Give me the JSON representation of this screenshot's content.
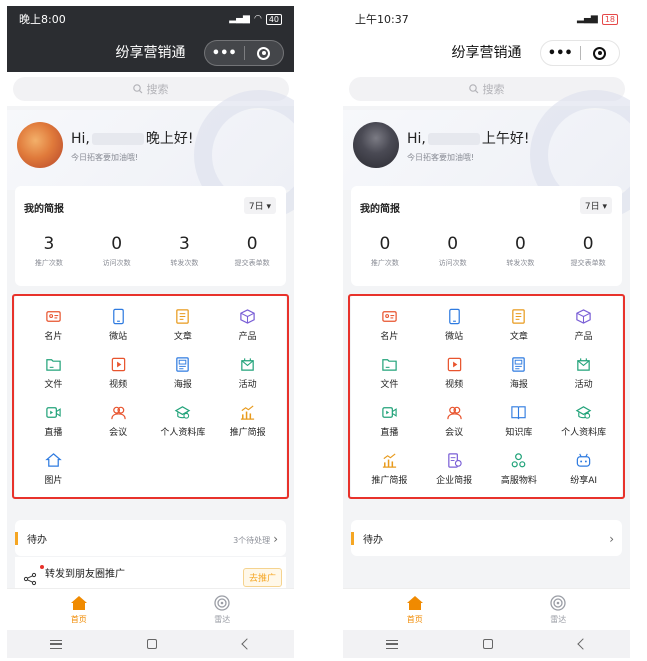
{
  "phones": [
    {
      "theme": "dark",
      "status": {
        "time": "晚上8:00",
        "battery": "40"
      },
      "title": "纷享营销通",
      "search_placeholder": "搜索",
      "greeting": {
        "prefix": "Hi,",
        "suffix": "晚上好!",
        "subtitle": "今日拓客要加油哦!"
      },
      "report": {
        "title": "我的简报",
        "period": "7日",
        "stats": [
          {
            "value": "3",
            "label": "推广次数"
          },
          {
            "value": "0",
            "label": "访问次数"
          },
          {
            "value": "3",
            "label": "转发次数"
          },
          {
            "value": "0",
            "label": "提交表单数"
          }
        ]
      },
      "grid": [
        {
          "label": "名片",
          "icon": "card-icon",
          "color": "#e8542e"
        },
        {
          "label": "微站",
          "icon": "tablet-icon",
          "color": "#2f7be0"
        },
        {
          "label": "文章",
          "icon": "article-icon",
          "color": "#e89a1c"
        },
        {
          "label": "产品",
          "icon": "cube-icon",
          "color": "#7a5fd6"
        },
        {
          "label": "文件",
          "icon": "folder-icon",
          "color": "#22a37a"
        },
        {
          "label": "视频",
          "icon": "video-icon",
          "color": "#e8542e"
        },
        {
          "label": "海报",
          "icon": "poster-icon",
          "color": "#2f7be0"
        },
        {
          "label": "活动",
          "icon": "event-icon",
          "color": "#22a37a"
        },
        {
          "label": "直播",
          "icon": "live-icon",
          "color": "#22a37a"
        },
        {
          "label": "会议",
          "icon": "meeting-icon",
          "color": "#e8542e"
        },
        {
          "label": "个人资料库",
          "icon": "library-icon",
          "color": "#22a37a"
        },
        {
          "label": "推广简报",
          "icon": "chart-icon",
          "color": "#e89a1c"
        },
        {
          "label": "图片",
          "icon": "home-icon",
          "color": "#2f7be0"
        }
      ],
      "todo": {
        "title": "待办",
        "right": "3个待处理",
        "arrow": "›"
      },
      "promo": {
        "text": "转发到朋友圈推广",
        "button": "去推广"
      },
      "tabs": [
        {
          "label": "首页",
          "active": true
        },
        {
          "label": "雷达",
          "active": false
        }
      ]
    },
    {
      "theme": "light",
      "status": {
        "time": "上午10:37",
        "battery": "18"
      },
      "title": "纷享营销通",
      "search_placeholder": "搜索",
      "greeting": {
        "prefix": "Hi,",
        "suffix": "上午好!",
        "subtitle": "今日拓客要加油哦!"
      },
      "report": {
        "title": "我的简报",
        "period": "7日",
        "stats": [
          {
            "value": "0",
            "label": "推广次数"
          },
          {
            "value": "0",
            "label": "访问次数"
          },
          {
            "value": "0",
            "label": "转发次数"
          },
          {
            "value": "0",
            "label": "提交表单数"
          }
        ]
      },
      "grid": [
        {
          "label": "名片",
          "icon": "card-icon",
          "color": "#e8542e"
        },
        {
          "label": "微站",
          "icon": "tablet-icon",
          "color": "#2f7be0"
        },
        {
          "label": "文章",
          "icon": "article-icon",
          "color": "#e89a1c"
        },
        {
          "label": "产品",
          "icon": "cube-icon",
          "color": "#7a5fd6"
        },
        {
          "label": "文件",
          "icon": "folder-icon",
          "color": "#22a37a"
        },
        {
          "label": "视频",
          "icon": "video-icon",
          "color": "#e8542e"
        },
        {
          "label": "海报",
          "icon": "poster-icon",
          "color": "#2f7be0"
        },
        {
          "label": "活动",
          "icon": "event-icon",
          "color": "#22a37a"
        },
        {
          "label": "直播",
          "icon": "live-icon",
          "color": "#22a37a"
        },
        {
          "label": "会议",
          "icon": "meeting-icon",
          "color": "#e8542e"
        },
        {
          "label": "知识库",
          "icon": "book-icon",
          "color": "#2f7be0"
        },
        {
          "label": "个人资料库",
          "icon": "library-icon",
          "color": "#22a37a"
        },
        {
          "label": "推广简报",
          "icon": "chart-icon",
          "color": "#e89a1c"
        },
        {
          "label": "企业简报",
          "icon": "report-icon",
          "color": "#7a5fd6"
        },
        {
          "label": "高服物料",
          "icon": "nodes-icon",
          "color": "#22a37a"
        },
        {
          "label": "纷享AI",
          "icon": "robot-icon",
          "color": "#2f7be0"
        }
      ],
      "todo": {
        "title": "待办",
        "right": "",
        "arrow": "›"
      },
      "promo": null,
      "tabs": [
        {
          "label": "首页",
          "active": true
        },
        {
          "label": "雷达",
          "active": false
        }
      ]
    }
  ]
}
